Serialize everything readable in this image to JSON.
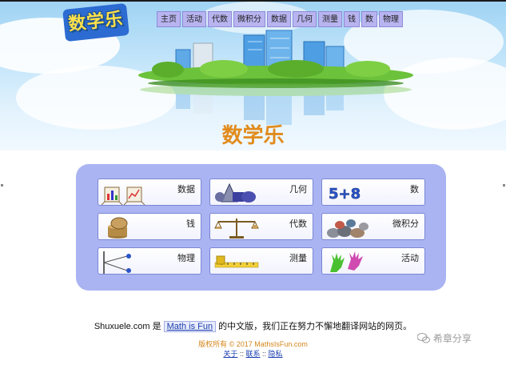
{
  "logo": {
    "text": "数学乐"
  },
  "nav": {
    "items": [
      {
        "label": "主页"
      },
      {
        "label": "活动"
      },
      {
        "label": "代数"
      },
      {
        "label": "微积分"
      },
      {
        "label": "数据"
      },
      {
        "label": "几何"
      },
      {
        "label": "测量"
      },
      {
        "label": "钱"
      },
      {
        "label": "数"
      },
      {
        "label": "物理"
      }
    ]
  },
  "site_title": "数学乐",
  "tiles": [
    {
      "label": "数据",
      "icon": "data-chart-icon"
    },
    {
      "label": "几何",
      "icon": "geometry-shapes-icon"
    },
    {
      "label": "数",
      "icon": "numbers-icon",
      "pic_text": "5+8"
    },
    {
      "label": "钱",
      "icon": "coins-icon"
    },
    {
      "label": "代数",
      "icon": "balance-scale-icon"
    },
    {
      "label": "微积分",
      "icon": "stones-icon"
    },
    {
      "label": "物理",
      "icon": "pendulum-icon"
    },
    {
      "label": "测量",
      "icon": "tape-measure-icon"
    },
    {
      "label": "活动",
      "icon": "hands-icon"
    }
  ],
  "footer": {
    "prefix": "Shuxuele.com 是",
    "link": "Math is Fun",
    "suffix": "的中文版，我们正在努力不懈地翻译网站的网页。",
    "copyright": "版权所有 © 2017 MathsIsFun.com",
    "links": [
      {
        "label": "关于"
      },
      {
        "label": "联系"
      },
      {
        "label": "隐私"
      }
    ],
    "separator": "::"
  },
  "watermark": {
    "text": "希章分享",
    "icon": "wechat-icon"
  },
  "colors": {
    "title_orange": "#e18b1c",
    "panel_purple": "#aab4f2",
    "nav_purple": "#b8b4f0",
    "link_blue": "#1a3eb0"
  }
}
